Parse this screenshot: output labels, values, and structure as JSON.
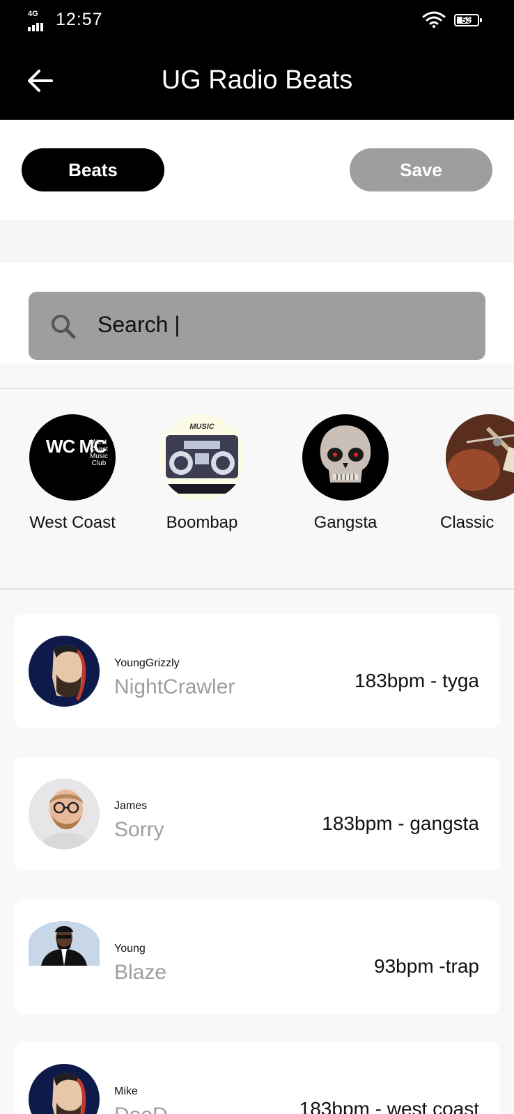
{
  "status_bar": {
    "network": "4G",
    "time": "12:57",
    "battery": "53"
  },
  "app_bar": {
    "title": "UG Radio Beats"
  },
  "tabs": {
    "beats_label": "Beats",
    "save_label": "Save"
  },
  "search": {
    "text": "Search |"
  },
  "genres": [
    {
      "label": "West Coast",
      "logo_text": "WC MC",
      "logo_sub": "West Coast Music Club"
    },
    {
      "label": "Boombap",
      "logo_text": "MUSIC"
    },
    {
      "label": "Gangsta"
    },
    {
      "label": "Classic"
    }
  ],
  "beats": [
    {
      "artist": "YoungGrizzly",
      "title": "NightCrawler",
      "meta": "183bpm - tyga"
    },
    {
      "artist": "James",
      "title": "Sorry",
      "meta": "183bpm - gangsta"
    },
    {
      "artist": "Young",
      "title": "Blaze",
      "meta": "93bpm -trap"
    },
    {
      "artist": "Mike",
      "title": "DooD",
      "meta": "183bpm - west coast"
    }
  ],
  "colors": {
    "bar_background": "#000000",
    "active_pill": "#000000",
    "inactive_pill": "#9e9e9e",
    "search_background": "#9e9e9e",
    "track_title": "#9e9e9e"
  }
}
